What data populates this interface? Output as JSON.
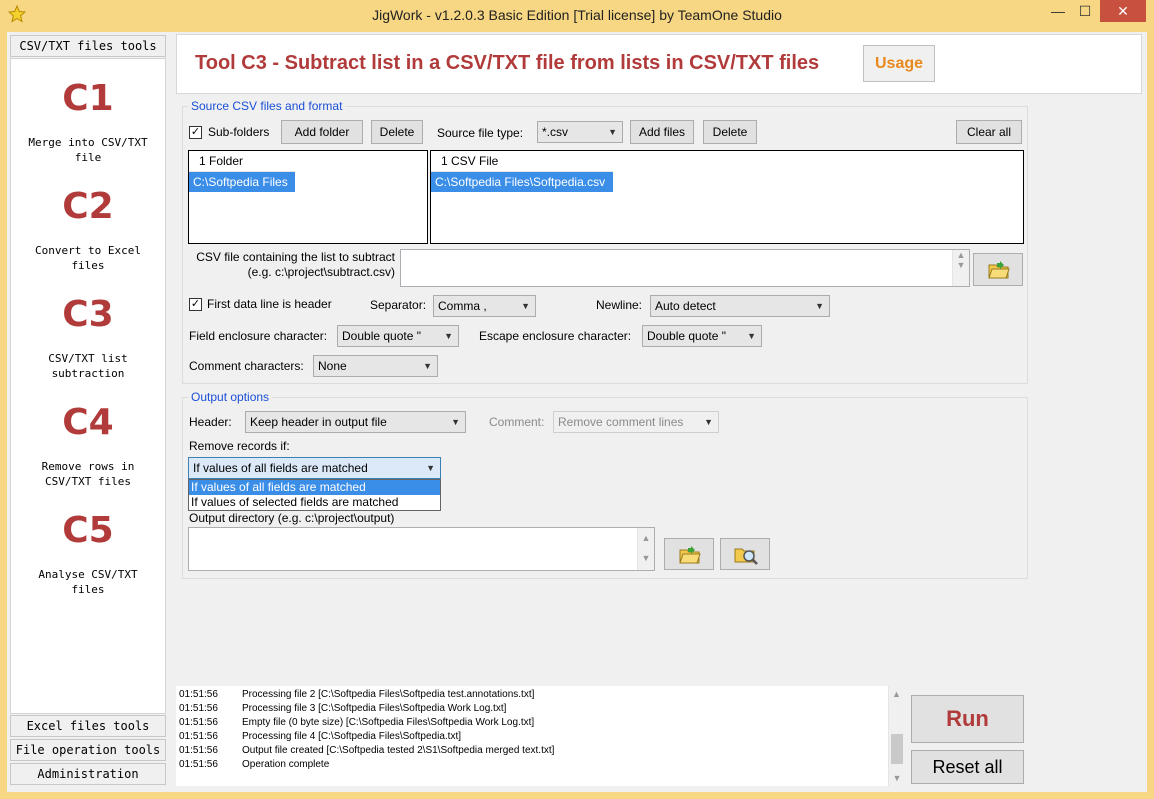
{
  "window": {
    "title": "JigWork - v1.2.0.3 Basic Edition [Trial license] by TeamOne Studio",
    "minimize": "—",
    "maximize": "☐",
    "close": "✕",
    "app_icon": "star-icon"
  },
  "sidebar": {
    "top_tab": "CSV/TXT files tools",
    "tools": [
      {
        "code": "C1",
        "label_lines": [
          "Merge into CSV/TXT",
          "file"
        ]
      },
      {
        "code": "C2",
        "label_lines": [
          "Convert to Excel",
          "files"
        ]
      },
      {
        "code": "C3",
        "label_lines": [
          "CSV/TXT list",
          "subtraction"
        ]
      },
      {
        "code": "C4",
        "label_lines": [
          "Remove rows in",
          "CSV/TXT files"
        ]
      },
      {
        "code": "C5",
        "label_lines": [
          "Analyse CSV/TXT",
          "files"
        ]
      }
    ],
    "bottom_tabs": [
      "Excel files tools",
      "File operation tools",
      "Administration"
    ]
  },
  "header": {
    "title": "Tool C3 - Subtract list in a CSV/TXT file from lists in CSV/TXT files",
    "usage_label": "Usage"
  },
  "source": {
    "group_label": "Source CSV files and format",
    "subfolders_label": "Sub-folders",
    "subfolders_checked": true,
    "add_folder_label": "Add folder",
    "delete_label": "Delete",
    "source_type_label": "Source file type:",
    "source_type_value": "*.csv",
    "add_files_label": "Add files",
    "delete_files_label": "Delete",
    "clear_all_label": "Clear all",
    "folders_header": "1 Folder",
    "folders": [
      "C:\\Softpedia Files"
    ],
    "files_header": "1 CSV File",
    "files": [
      "C:\\Softpedia Files\\Softpedia.csv"
    ],
    "subtract_label_line1": "CSV file containing the list to subtract",
    "subtract_label_line2": "(e.g. c:\\project\\subtract.csv)",
    "subtract_value": "",
    "first_line_header_label": "First data line is header",
    "first_line_header_checked": true,
    "separator_label": "Separator:",
    "separator_value": "Comma  ,",
    "newline_label": "Newline:",
    "newline_value": "Auto detect",
    "field_enclosure_label": "Field enclosure character:",
    "field_enclosure_value": "Double quote  \"",
    "escape_enclosure_label": "Escape enclosure character:",
    "escape_enclosure_value": "Double quote  \"",
    "comment_chars_label": "Comment characters:",
    "comment_chars_value": "None"
  },
  "output": {
    "group_label": "Output options",
    "header_label": "Header:",
    "header_value": "Keep header in output file",
    "comment_label": "Comment:",
    "comment_value": "Remove comment lines",
    "remove_records_label": "Remove records if:",
    "remove_records_value": "If values of all fields are matched",
    "remove_records_options": [
      "If values of all fields are matched",
      "If values of selected fields are matched"
    ],
    "output_dir_label": "Output directory (e.g. c:\\project\\output)",
    "output_dir_value": ""
  },
  "log": {
    "lines": [
      {
        "time": "01:51:56",
        "msg": "Processing file 2 [C:\\Softpedia Files\\Softpedia test.annotations.txt]"
      },
      {
        "time": "01:51:56",
        "msg": "Processing file 3 [C:\\Softpedia Files\\Softpedia Work Log.txt]"
      },
      {
        "time": "01:51:56",
        "msg": "Empty file (0 byte size) [C:\\Softpedia Files\\Softpedia Work Log.txt]"
      },
      {
        "time": "01:51:56",
        "msg": "Processing file 4 [C:\\Softpedia Files\\Softpedia.txt]"
      },
      {
        "time": "01:51:56",
        "msg": "Output file created [C:\\Softpedia tested 2\\S1\\Softpedia merged text.txt]"
      },
      {
        "time": "01:51:56",
        "msg": "Operation complete"
      }
    ]
  },
  "actions": {
    "run_label": "Run",
    "reset_label": "Reset all"
  },
  "colors": {
    "accent_red": "#b13a3a",
    "usage_orange": "#e88a1e",
    "group_label_blue": "#1a4fd6",
    "selection_blue": "#3b8ee8",
    "titlebar": "#f7d783"
  }
}
